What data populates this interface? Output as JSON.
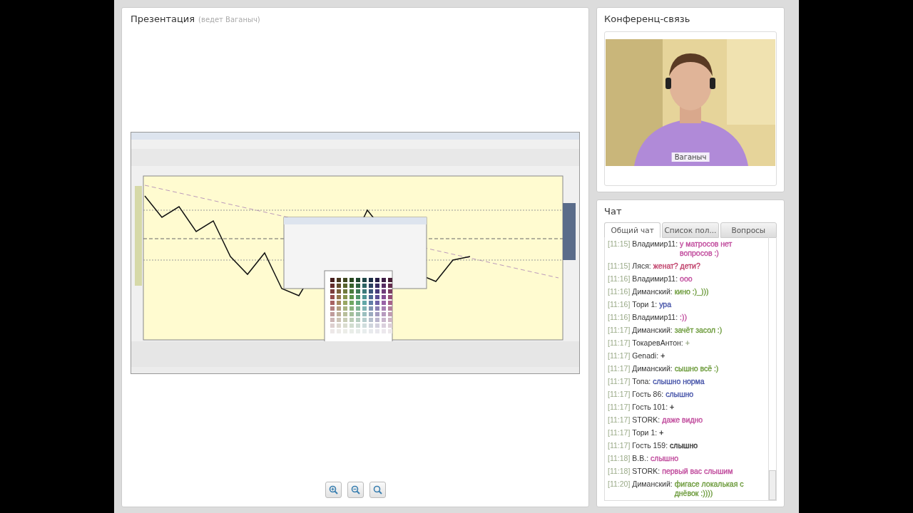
{
  "presentation": {
    "title": "Презентация",
    "host": "(ведет Ваганыч)"
  },
  "conference": {
    "title": "Конференц-связь",
    "video_label": "Ваганыч"
  },
  "chat": {
    "title": "Чат",
    "tabs": [
      {
        "label": "Общий чат",
        "selected": true
      },
      {
        "label": "Список пол...",
        "selected": false
      },
      {
        "label": "Вопросы",
        "selected": false
      }
    ],
    "messages": [
      {
        "time": "[11:15]",
        "author": "Владимир11:",
        "text": "у матросов нет вопросов :)",
        "color": "#c04a9c"
      },
      {
        "time": "[11:15]",
        "author": "Ляся:",
        "text": "женат? дети?",
        "color": "#c0406a"
      },
      {
        "time": "[11:16]",
        "author": "Владимир11:",
        "text": "ооо",
        "color": "#c04a9c"
      },
      {
        "time": "[11:16]",
        "author": "Диманский:",
        "text": "кино :)_)))",
        "color": "#6b9a3a"
      },
      {
        "time": "[11:16]",
        "author": "Тори 1:",
        "text": "ура",
        "color": "#4452a8"
      },
      {
        "time": "[11:16]",
        "author": "Владимир11:",
        "text": ":))",
        "color": "#c04a9c"
      },
      {
        "time": "[11:17]",
        "author": "Диманский:",
        "text": "зачёт засол :)",
        "color": "#6b9a3a"
      },
      {
        "time": "[11:17]",
        "author": "ТокаревАнтон:",
        "text": "+",
        "color": "#9aaa88"
      },
      {
        "time": "[11:17]",
        "author": "Genadi:",
        "text": "+",
        "color": "#333333"
      },
      {
        "time": "[11:17]",
        "author": "Диманский:",
        "text": "сышно всё :)",
        "color": "#6b9a3a"
      },
      {
        "time": "[11:17]",
        "author": "Топа:",
        "text": "слышно норма",
        "color": "#4452a8"
      },
      {
        "time": "[11:17]",
        "author": "Гость 86:",
        "text": "слышно",
        "color": "#4452a8"
      },
      {
        "time": "[11:17]",
        "author": "Гость 101:",
        "text": "+",
        "color": "#333333"
      },
      {
        "time": "[11:17]",
        "author": "STORK:",
        "text": "даже видно",
        "color": "#c04a9c"
      },
      {
        "time": "[11:17]",
        "author": "Тори 1:",
        "text": "+",
        "color": "#333333"
      },
      {
        "time": "[11:17]",
        "author": "Гость 159:",
        "text": "слышно",
        "color": "#333333"
      },
      {
        "time": "[11:18]",
        "author": "B.B.:",
        "text": "слышно",
        "color": "#c04a9c"
      },
      {
        "time": "[11:18]",
        "author": "STORK:",
        "text": "первый вас слышим",
        "color": "#c04a9c"
      },
      {
        "time": "[11:20]",
        "author": "Диманский:",
        "text": "фигасе локалькая с днёвок :))))",
        "color": "#6b9a3a"
      }
    ]
  }
}
